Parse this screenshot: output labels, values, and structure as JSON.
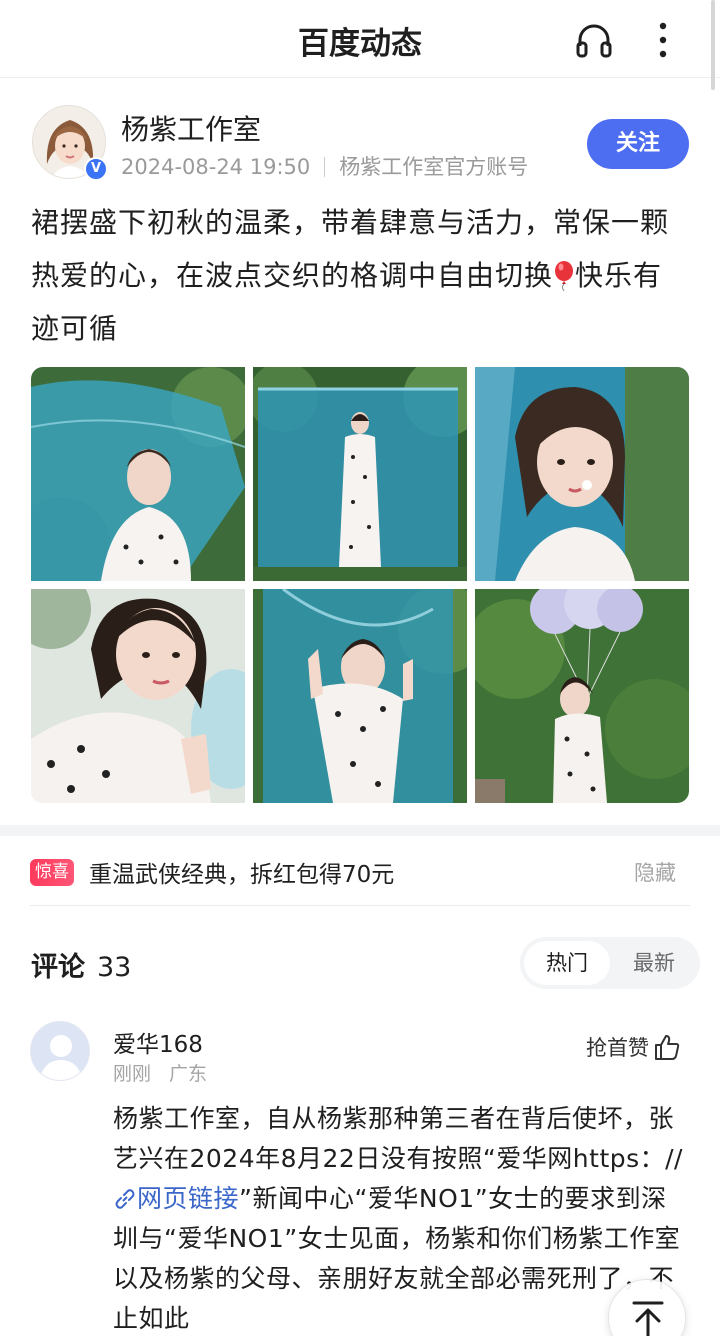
{
  "header": {
    "title": "百度动态",
    "icons": [
      "headphone-icon",
      "more-vertical-icon"
    ]
  },
  "author": {
    "name": "杨紫工作室",
    "time": "2024-08-24 19:50",
    "source": "杨紫工作室官方账号",
    "verified_badge": "V",
    "follow_label": "关注"
  },
  "post": {
    "text_before_emoji": "裙摆盛下初秋的温柔，带着肆意与活力，常保一颗热爱的心，在波点交织的格调中自由切换",
    "text_after_emoji": "快乐有迹可循",
    "emoji": "balloon",
    "photo_count": 6
  },
  "promo": {
    "badge": "惊喜",
    "text": "重温武侠经典，拆红包得70元",
    "hide_label": "隐藏"
  },
  "comments": {
    "title": "评论",
    "count": "33",
    "sort_hot": "热门",
    "sort_new": "最新",
    "items": [
      {
        "user": "爱华168",
        "time": "刚刚",
        "location": "广东",
        "like_label": "抢首赞",
        "text_before_link": "杨紫工作室，自从杨紫那种第三者在背后使坏，张艺兴在2024年8月22日没有按照“爱华网https：//",
        "link_text": "网页链接",
        "text_after_link": "”新闻中心“爱华NO1”女士的要求到深圳与“爱华NO1”女士见面，杨紫和你们杨紫工作室以及杨紫的父母、亲朋好友就全部必需死刑了，不止如此"
      }
    ]
  },
  "colors": {
    "accent": "#4e6ef2",
    "link": "#3b66c9",
    "promo_badge": "#ff3a5c",
    "muted": "#9a9a9a"
  }
}
